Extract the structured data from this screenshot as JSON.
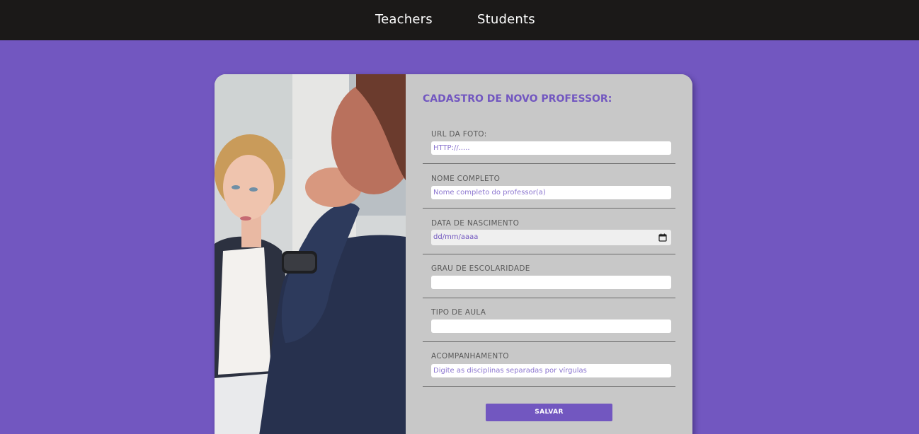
{
  "nav": {
    "teachers_label": "Teachers",
    "students_label": "Students"
  },
  "form": {
    "title": "CADASTRO DE NOVO PROFESSOR:",
    "fields": [
      {
        "label": "URL DA FOTO:",
        "placeholder": "HTTP://.....",
        "value": ""
      },
      {
        "label": "NOME COMPLETO",
        "placeholder": "Nome completo do professor(a)",
        "value": ""
      },
      {
        "label": "DATA DE NASCIMENTO",
        "placeholder": "dd/mm/aaaa",
        "value": ""
      },
      {
        "label": "GRAU DE ESCOLARIDADE",
        "placeholder": "",
        "value": ""
      },
      {
        "label": "TIPO DE AULA",
        "placeholder": "",
        "value": ""
      },
      {
        "label": "ACOMPANHAMENTO",
        "placeholder": "Digite as disciplinas separadas por vírgulas",
        "value": ""
      }
    ],
    "submit_label": "SALVAR"
  },
  "icons": {
    "date_picker": "calendar-icon"
  },
  "colors": {
    "accent": "#7257c0",
    "topbar": "#1b1918",
    "panel": "#c8c8c8",
    "label": "#5a5a5a"
  }
}
